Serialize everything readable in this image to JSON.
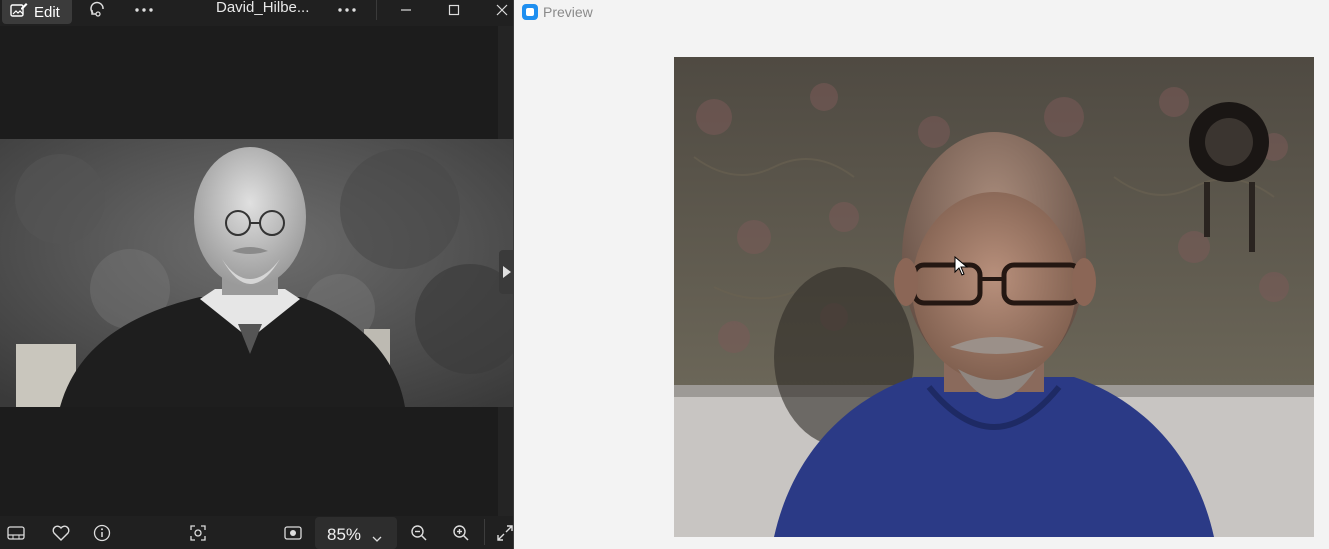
{
  "viewer": {
    "edit_label": "Edit",
    "file_name": "David_Hilbe...",
    "zoom_level": "85%"
  },
  "preview": {
    "title": "Preview"
  },
  "colors": {
    "viewer_bg": "#202020",
    "preview_bg": "#f3f3f3",
    "preview_accent": "#1e8ff0"
  }
}
